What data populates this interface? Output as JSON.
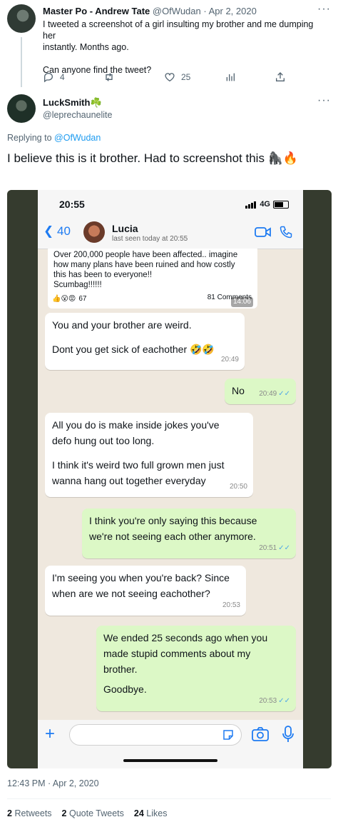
{
  "tweet1": {
    "name": "Master Po - Andrew Tate",
    "handle": "@OfWudan",
    "date": "· Apr 2, 2020",
    "text_line1": "I tweeted a screenshot of a girl insulting my brother and me dumping her",
    "text_line2": "instantly. Months ago.",
    "text_line3": "Can anyone find the tweet?",
    "replies": "4",
    "likes": "25"
  },
  "tweet2": {
    "name": "LuckSmith",
    "name_emoji": "☘️",
    "handle": "@leprechaunelite",
    "replying_label": "Replying to",
    "replying_handle": "@OfWudan",
    "text": "I believe this is it brother. Had to screenshot this 🦍🔥",
    "timestamp": "12:43 PM · Apr 2, 2020",
    "retweets_count": "2",
    "retweets_label": "Retweets",
    "quotes_count": "2",
    "quotes_label": "Quote Tweets",
    "likes_count": "24",
    "likes_label": "Likes"
  },
  "phone": {
    "time": "20:55",
    "network": "4G",
    "back_count": "40",
    "contact_name": "Lucia",
    "last_seen": "last seen today at 20:55"
  },
  "forwarded": {
    "line1": "Over 200,000 people have been affected.. imagine",
    "line2": "how many plans have been ruined and how costly",
    "line3": "this has been to everyone!!",
    "line4": "Scumbag!!!!!!",
    "reactions": "67",
    "comments": "81 Comments",
    "time": "14:06"
  },
  "messages": [
    {
      "line1": "You and your brother are weird.",
      "line2": "Dont you get sick of eachother 🤣🤣",
      "time": "20:49"
    },
    {
      "line1": "No",
      "time": "20:49"
    },
    {
      "line1": "All you do is make inside jokes you've",
      "line2": "defo hung out too long.",
      "line3": "I think it's weird two full grown men just",
      "line4": "wanna hang out together everyday",
      "time": "20:50"
    },
    {
      "line1": "I think you're only saying this because",
      "line2": "we're not seeing each other anymore.",
      "time": "20:51"
    },
    {
      "line1": "I'm seeing you when you're back? Since",
      "line2": "when are we not  seeing eachother?",
      "time": "20:53"
    },
    {
      "line1": "We ended 25 seconds ago when you",
      "line2": "made stupid comments about my",
      "line3": "brother.",
      "line4": "Goodbye.",
      "time": "20:53"
    }
  ],
  "colors": {
    "link": "#1d9bf0",
    "whatsapp_blue": "#1e7bf2",
    "outgoing_bubble": "#dcf8c6"
  }
}
